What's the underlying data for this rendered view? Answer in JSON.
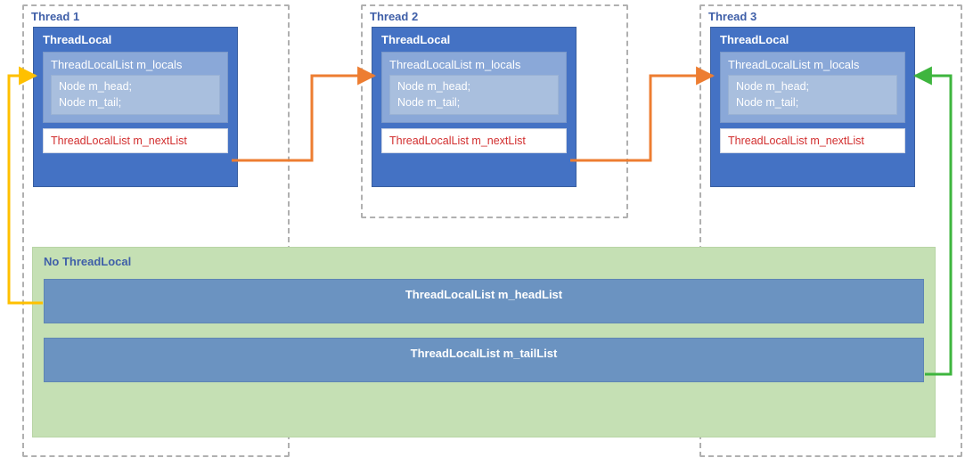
{
  "threads": [
    {
      "title": "Thread 1"
    },
    {
      "title": "Thread 2"
    },
    {
      "title": "Thread 3"
    }
  ],
  "threadLocal": {
    "outerTitle": "ThreadLocal",
    "localsTitle": "ThreadLocalList m_locals",
    "nodeLine1": "Node m_head;",
    "nodeLine2": "Node m_tail;",
    "nextList": "ThreadLocalList m_nextList"
  },
  "noThreadLocal": {
    "title": "No ThreadLocal",
    "headList": "ThreadLocalList m_headList",
    "tailList": "ThreadLocalList m_tailList"
  },
  "colors": {
    "orange": "#ED7D31",
    "yellow": "#FFC000",
    "green": "#3EB53E"
  }
}
